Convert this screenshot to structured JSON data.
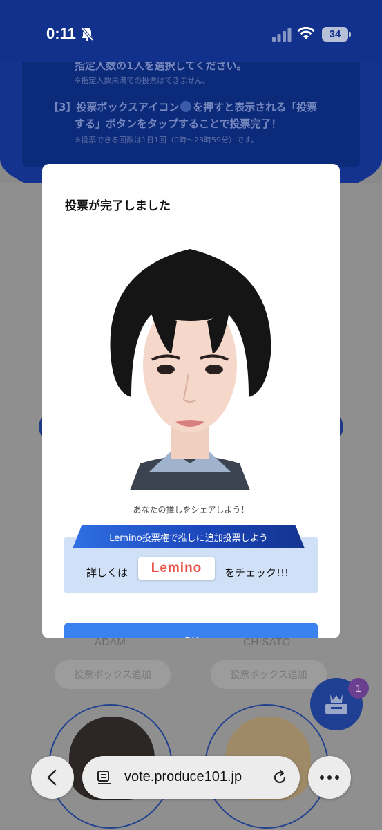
{
  "status_bar": {
    "time": "0:11",
    "battery": "34"
  },
  "background": {
    "instruction_line1": "指定人数の1人を選択してください。",
    "instruction_note1": "※指定人数未満での投票はできません。",
    "step3_prefix": "【3】投票ボックスアイコン",
    "step3_suffix": "を押すと表示される「投票",
    "step3_line2": "する」ボタンをタップすることで投票完了！",
    "step3_note": "※投票できる回数は1日1回（0時〜23時59分）です。",
    "candidates": [
      {
        "name": "ADAM",
        "button": "投票ボックス追加"
      },
      {
        "name": "CHISATO",
        "button": "投票ボックス追加"
      }
    ],
    "vote_box_badge": "1"
  },
  "modal": {
    "title": "投票が完了しました",
    "share_text": "あなたの推しをシェアしよう！",
    "lemino_banner": "Lemino投票権で推しに追加投票しよう",
    "detail_prefix": "詳しくは",
    "lemino_logo": "Lemino",
    "detail_suffix": "をチェック!!!",
    "ok_label": "OK"
  },
  "browser": {
    "url": "vote.produce101.jp"
  },
  "colors": {
    "brand_navy": "#12318c",
    "ok_blue": "#3a82f0",
    "lemino_box": "#cfe0f7",
    "lemino_red": "#e9554a"
  }
}
